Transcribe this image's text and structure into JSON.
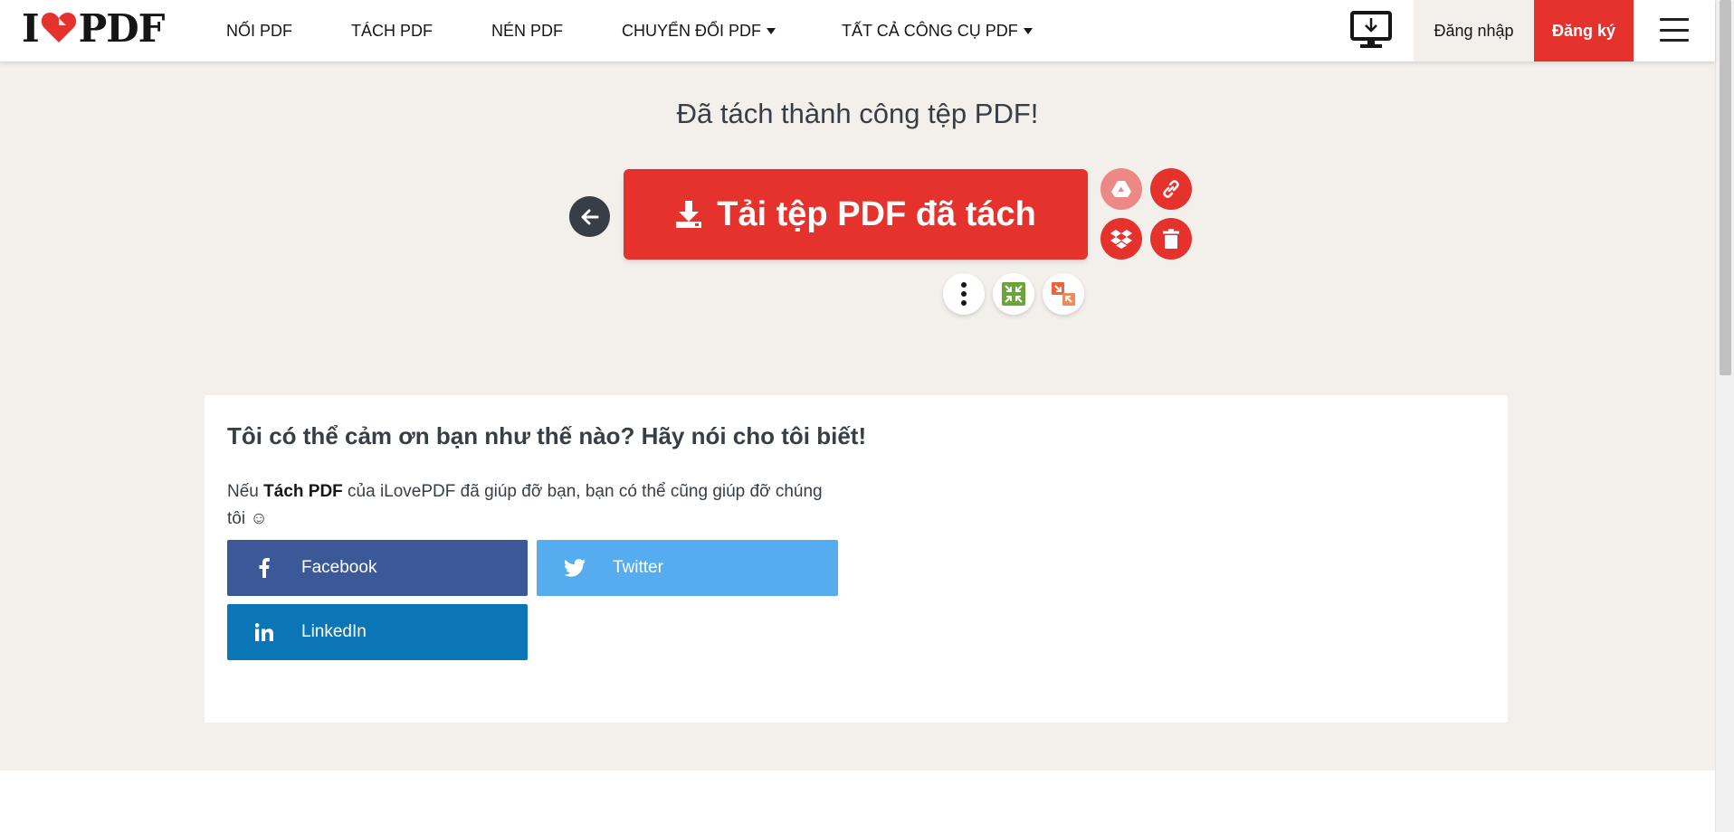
{
  "header": {
    "logo": {
      "left": "I",
      "right": "PDF"
    },
    "nav": [
      {
        "label": "NỐI PDF",
        "dropdown": false
      },
      {
        "label": "TÁCH PDF",
        "dropdown": false
      },
      {
        "label": "NÉN PDF",
        "dropdown": false
      },
      {
        "label": "CHUYỂN ĐỔI PDF",
        "dropdown": true
      },
      {
        "label": "TẤT CẢ CÔNG CỤ PDF",
        "dropdown": true
      }
    ],
    "login_label": "Đăng nhập",
    "signup_label": "Đăng ký"
  },
  "result": {
    "title": "Đã tách thành công tệp PDF!",
    "download_label": "Tải tệp PDF đã tách"
  },
  "share": {
    "title": "Tôi có thể cảm ơn bạn như thế nào? Hãy nói cho tôi biết!",
    "text_before": "Nếu ",
    "tool_name": "Tách PDF",
    "text_after": " của iLovePDF đã giúp đỡ bạn, bạn có thể cũng giúp đỡ chúng tôi ☺",
    "facebook_label": "Facebook",
    "twitter_label": "Twitter",
    "linkedin_label": "LinkedIn"
  },
  "colors": {
    "brand_red": "#e5322d",
    "dark": "#383e45",
    "facebook": "#3b5998",
    "twitter": "#55acee",
    "linkedin": "#0a76b7"
  }
}
